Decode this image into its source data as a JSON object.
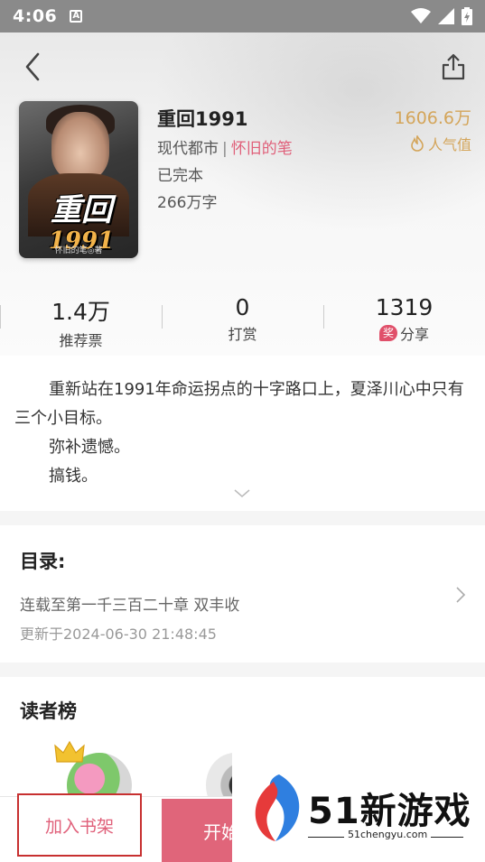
{
  "status_bar": {
    "time": "4:06",
    "notification_letter": "A"
  },
  "book": {
    "title": "重回1991",
    "category": "现代都市",
    "separator": "|",
    "author": "怀旧的笔",
    "status": "已完本",
    "word_count": "266万字",
    "popularity_value": "1606.6万",
    "popularity_label": "人气值",
    "cover": {
      "title_top": "重回",
      "title_year": "1991",
      "author_line": "怀旧的笔◎著"
    }
  },
  "stats": [
    {
      "value": "1.4万",
      "label": "推荐票"
    },
    {
      "value": "0",
      "label": "打赏"
    },
    {
      "value": "1319",
      "label": "分享",
      "badge": "奖"
    }
  ],
  "intro": {
    "paragraphs": [
      "重新站在1991年命运拐点的十字路口上，夏泽川心中只有三个小目标。",
      "弥补遗憾。",
      "搞钱。"
    ]
  },
  "toc": {
    "title": "目录:",
    "latest_chapter": "连载至第一千三百二十章 双丰收",
    "updated": "更新于2024-06-30 21:48:45"
  },
  "readers": {
    "title": "读者榜"
  },
  "bottom_bar": {
    "add_shelf_label": "加入书架",
    "start_read_label": "开始"
  },
  "watermark": {
    "text": "51新游戏",
    "url": "51chengyu.com"
  },
  "colors": {
    "accent": "#e0607a",
    "gold": "#d4a55a",
    "status_bar": "#8a8a8a"
  }
}
